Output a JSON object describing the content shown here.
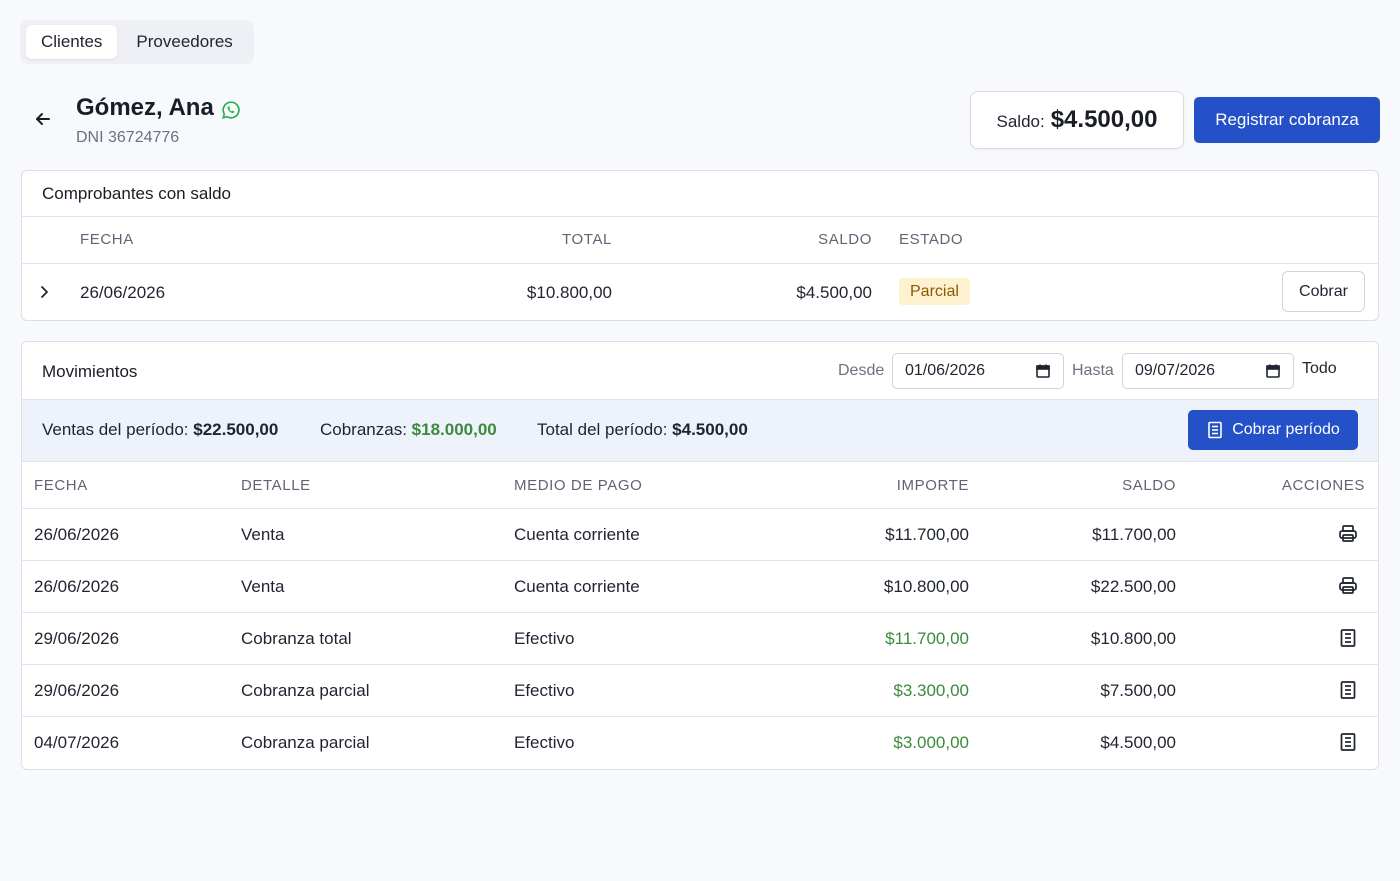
{
  "tabs": [
    {
      "label": "Clientes",
      "active": true
    },
    {
      "label": "Proveedores",
      "active": false
    }
  ],
  "client": {
    "name": "Gómez, Ana",
    "dni": "DNI 36724776"
  },
  "saldo": {
    "label": "Saldo:",
    "value": "$4.500,00"
  },
  "registrar_label": "Registrar cobranza",
  "comprobantes": {
    "title": "Comprobantes con saldo",
    "headers": {
      "fecha": "FECHA",
      "total": "TOTAL",
      "saldo": "SALDO",
      "estado": "ESTADO"
    },
    "rows": [
      {
        "fecha": "26/06/2026",
        "total": "$10.800,00",
        "saldo": "$4.500,00",
        "estado": "Parcial",
        "action": "Cobrar"
      }
    ]
  },
  "movimientos": {
    "title": "Movimientos",
    "desde_label": "Desde",
    "desde_value": "01/06/2026",
    "hasta_label": "Hasta",
    "hasta_value": "09/07/2026",
    "todo_label": "Todo",
    "summary": {
      "ventas_label": "Ventas del período:",
      "ventas_value": "$22.500,00",
      "cobranzas_label": "Cobranzas:",
      "cobranzas_value": "$18.000,00",
      "total_label": "Total del período:",
      "total_value": "$4.500,00",
      "cobrar_periodo_label": "Cobrar período"
    },
    "headers": {
      "fecha": "FECHA",
      "detalle": "DETALLE",
      "medio": "MEDIO DE PAGO",
      "importe": "IMPORTE",
      "saldo": "SALDO",
      "acciones": "ACCIONES"
    },
    "rows": [
      {
        "fecha": "26/06/2026",
        "detalle": "Venta",
        "medio": "Cuenta corriente",
        "importe": "$11.700,00",
        "saldo": "$11.700,00",
        "icon": "printer-icon"
      },
      {
        "fecha": "26/06/2026",
        "detalle": "Venta",
        "medio": "Cuenta corriente",
        "importe": "$10.800,00",
        "saldo": "$22.500,00",
        "icon": "printer-icon"
      },
      {
        "fecha": "29/06/2026",
        "detalle": "Cobranza total",
        "medio": "Efectivo",
        "importe": "$11.700,00",
        "saldo": "$10.800,00",
        "icon": "receipt-icon"
      },
      {
        "fecha": "29/06/2026",
        "detalle": "Cobranza parcial",
        "medio": "Efectivo",
        "importe": "$3.300,00",
        "saldo": "$7.500,00",
        "icon": "receipt-icon"
      },
      {
        "fecha": "04/07/2026",
        "detalle": "Cobranza parcial",
        "medio": "Efectivo",
        "importe": "$3.000,00",
        "saldo": "$4.500,00",
        "icon": "receipt-icon"
      }
    ]
  },
  "colors": {
    "primary": "#2450c8",
    "positive": "#3c8a3c",
    "badge_bg": "#fdf1d0",
    "whatsapp": "#25b34b"
  }
}
